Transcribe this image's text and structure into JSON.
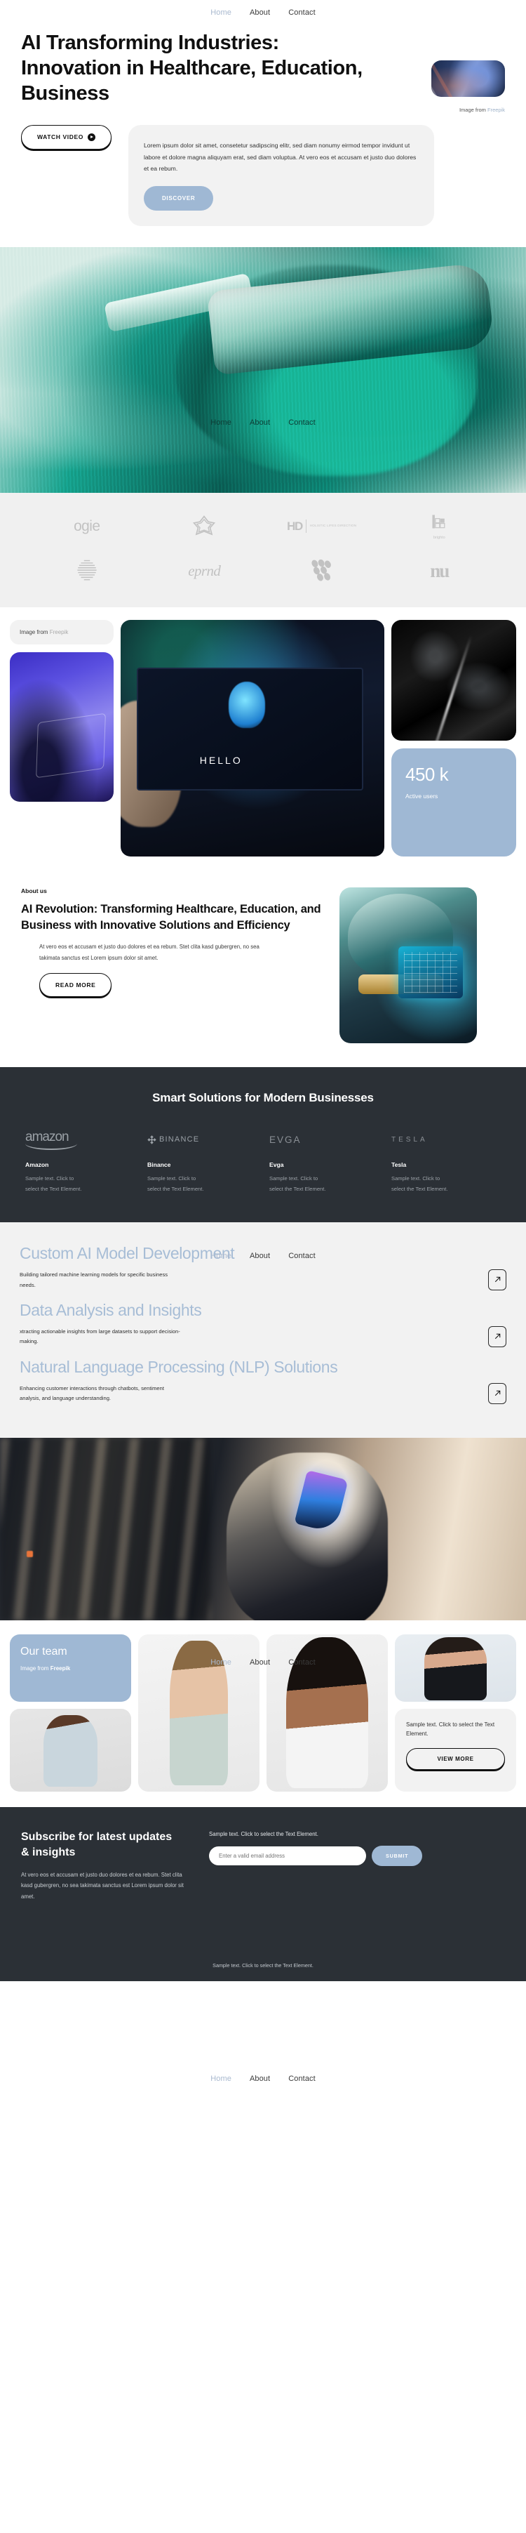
{
  "nav": {
    "items": [
      {
        "label": "Home",
        "active": true
      },
      {
        "label": "About",
        "active": false
      },
      {
        "label": "Contact",
        "active": false
      }
    ]
  },
  "hero": {
    "heading": "AI Transforming Industries: Innovation in Healthcare, Education, Business",
    "credit_prefix": "Image from ",
    "credit_source": "Freepik",
    "watch_video_label": "WATCH VIDEO",
    "paragraph": "Lorem ipsum dolor sit amet, consetetur sadipscing elitr, sed diam nonumy eirmod tempor invidunt ut labore et dolore magna aliquyam erat, sed diam voluptua. At vero eos et accusam et justo duo dolores et ea rebum.",
    "discover_label": "DISCOVER"
  },
  "logos": {
    "items": [
      {
        "name": "ogie",
        "type": "wordmark"
      },
      {
        "name": "flower-mark",
        "type": "mark"
      },
      {
        "name": "HD",
        "sub": "HOLISTIC LIFES DIRECTION",
        "type": "hd"
      },
      {
        "name": "brighto",
        "type": "brighto"
      },
      {
        "name": "striped-circle",
        "type": "mark"
      },
      {
        "name": "eprnd",
        "type": "wordmark"
      },
      {
        "name": "dots-grid",
        "type": "mark"
      },
      {
        "name": "nu",
        "type": "wordmark"
      }
    ]
  },
  "gallery": {
    "credit_prefix": "Image from ",
    "credit_source": "Freepik",
    "screen_text": "HELLO",
    "stat_number": "450 k",
    "stat_label": "Active users"
  },
  "about": {
    "eyebrow": "About us",
    "heading": "AI Revolution: Transforming Healthcare, Education, and Business with Innovative Solutions and Efficiency",
    "paragraph": "At vero eos et accusam et justo duo dolores et ea rebum. Stet clita kasd gubergren, no sea takimata sanctus est Lorem ipsum dolor sit amet.",
    "read_more_label": "READ MORE"
  },
  "brands": {
    "heading": "Smart Solutions for Modern Businesses",
    "items": [
      {
        "logo": "amazon",
        "name": "Amazon",
        "desc": "Sample text. Click to select the Text Element."
      },
      {
        "logo": "BINANCE",
        "name": "Binance",
        "desc": "Sample text. Click to select the Text Element."
      },
      {
        "logo": "EVGA",
        "name": "Evga",
        "desc": "Sample text. Click to select the Text Element."
      },
      {
        "logo": "TESLA",
        "name": "Tesla",
        "desc": "Sample text. Click to select the Text Element."
      }
    ]
  },
  "services": {
    "items": [
      {
        "title": "Custom AI Model Development",
        "desc": "Building tailored machine learning models for specific business needs."
      },
      {
        "title": "Data Analysis and Insights",
        "desc": "xtracting actionable insights from large datasets to support decision-making."
      },
      {
        "title": "Natural Language Processing (NLP) Solutions",
        "desc": "Enhancing customer interactions through chatbots, sentiment analysis, and language understanding."
      }
    ]
  },
  "team": {
    "title": "Our team",
    "credit_prefix": "Image from ",
    "credit_source": "Freepik",
    "note": "Sample text. Click to select the Text Element.",
    "view_more_label": "VIEW MORE"
  },
  "footer": {
    "heading": "Subscribe for latest updates & insights",
    "paragraph": "At vero eos et accusam et justo duo dolores et ea rebum. Stet clita kasd gubergren, no sea takimata sanctus est Lorem ipsum dolor sit amet.",
    "note": "Sample text. Click to select the Text Element.",
    "email_placeholder": "Enter a valid email address",
    "submit_label": "SUBMIT",
    "bottom_note": "Sample text. Click to select the Text Element."
  },
  "colors": {
    "accent_blue": "#9fb8d4",
    "dark": "#2b3036",
    "light_gray": "#f2f2f2",
    "service_heading": "#a7bdd6"
  }
}
